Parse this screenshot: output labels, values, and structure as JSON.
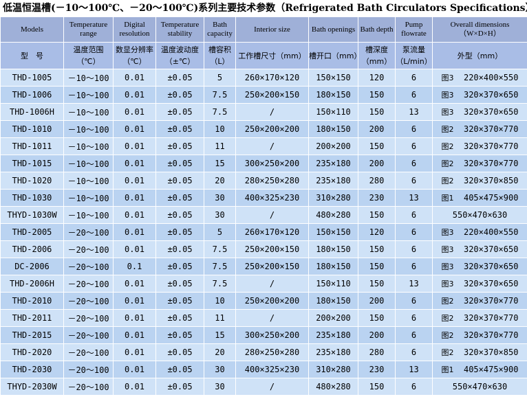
{
  "title": "低温恒温槽(－10～100℃、－20～100℃)系列主要技术参数（Refrigerated Bath Circulators Specifications）",
  "headers_en": [
    "Models",
    "Temperature range",
    "Digital resolution",
    "Temperature stability",
    "Bath capacity",
    "Interior size",
    "Bath openings",
    "Bath depth",
    "Pump flowrate",
    "Overall dimensions（W×D×H）"
  ],
  "headers_cn": [
    "型　号",
    "温度范围（℃）",
    "数显分辨率（℃）",
    "温度波动度（±℃）",
    "槽容积（L）",
    "工作槽尺寸（mm）",
    "槽开口（mm）",
    "槽深度（mm）",
    "泵流量（L/min）",
    "外型（mm）"
  ],
  "rows": [
    {
      "model": "THD-1005",
      "range": "－10～100",
      "res": "0.01",
      "stab": "±0.05",
      "cap": "5",
      "interior": "260×170×120",
      "opening": "150×150",
      "depth": "120",
      "flow": "6",
      "fig": "图3",
      "dims": "220×400×550"
    },
    {
      "model": "THD-1006",
      "range": "－10～100",
      "res": "0.01",
      "stab": "±0.05",
      "cap": "7.5",
      "interior": "250×200×150",
      "opening": "180×150",
      "depth": "150",
      "flow": "6",
      "fig": "图3",
      "dims": "320×370×650"
    },
    {
      "model": "THD-1006H",
      "range": "－10～100",
      "res": "0.01",
      "stab": "±0.05",
      "cap": "7.5",
      "interior": "/",
      "opening": "150×110",
      "depth": "150",
      "flow": "13",
      "fig": "图3",
      "dims": "320×370×650"
    },
    {
      "model": "THD-1010",
      "range": "－10～100",
      "res": "0.01",
      "stab": "±0.05",
      "cap": "10",
      "interior": "250×200×200",
      "opening": "180×150",
      "depth": "200",
      "flow": "6",
      "fig": "图2",
      "dims": "320×370×770"
    },
    {
      "model": "THD-1011",
      "range": "－10～100",
      "res": "0.01",
      "stab": "±0.05",
      "cap": "11",
      "interior": "/",
      "opening": "200×200",
      "depth": "150",
      "flow": "6",
      "fig": "图2",
      "dims": "320×370×770"
    },
    {
      "model": "THD-1015",
      "range": "－10～100",
      "res": "0.01",
      "stab": "±0.05",
      "cap": "15",
      "interior": "300×250×200",
      "opening": "235×180",
      "depth": "200",
      "flow": "6",
      "fig": "图2",
      "dims": "320×370×770"
    },
    {
      "model": "THD-1020",
      "range": "－10～100",
      "res": "0.01",
      "stab": "±0.05",
      "cap": "20",
      "interior": "280×250×280",
      "opening": "235×180",
      "depth": "280",
      "flow": "6",
      "fig": "图2",
      "dims": "320×370×850"
    },
    {
      "model": "THD-1030",
      "range": "－10～100",
      "res": "0.01",
      "stab": "±0.05",
      "cap": "30",
      "interior": "400×325×230",
      "opening": "310×280",
      "depth": "230",
      "flow": "13",
      "fig": "图1",
      "dims": "405×475×900"
    },
    {
      "model": "THYD-1030W",
      "range": "－10～100",
      "res": "0.01",
      "stab": "±0.05",
      "cap": "30",
      "interior": "/",
      "opening": "480×280",
      "depth": "150",
      "flow": "6",
      "fig": "",
      "dims": "550×470×630"
    },
    {
      "model": "THD-2005",
      "range": "－20～100",
      "res": "0.01",
      "stab": "±0.05",
      "cap": "5",
      "interior": "260×170×120",
      "opening": "150×150",
      "depth": "120",
      "flow": "6",
      "fig": "图3",
      "dims": "220×400×550"
    },
    {
      "model": "THD-2006",
      "range": "－20～100",
      "res": "0.01",
      "stab": "±0.05",
      "cap": "7.5",
      "interior": "250×200×150",
      "opening": "180×150",
      "depth": "150",
      "flow": "6",
      "fig": "图3",
      "dims": "320×370×650"
    },
    {
      "model": "DC-2006",
      "range": "－20～100",
      "res": "0.1",
      "stab": "±0.05",
      "cap": "7.5",
      "interior": "250×200×150",
      "opening": "180×150",
      "depth": "150",
      "flow": "6",
      "fig": "图3",
      "dims": "320×370×650"
    },
    {
      "model": "THD-2006H",
      "range": "－20～100",
      "res": "0.01",
      "stab": "±0.05",
      "cap": "7.5",
      "interior": "/",
      "opening": "150×110",
      "depth": "150",
      "flow": "13",
      "fig": "图3",
      "dims": "320×370×650"
    },
    {
      "model": "THD-2010",
      "range": "－20～100",
      "res": "0.01",
      "stab": "±0.05",
      "cap": "10",
      "interior": "250×200×200",
      "opening": "180×150",
      "depth": "200",
      "flow": "6",
      "fig": "图2",
      "dims": "320×370×770"
    },
    {
      "model": "THD-2011",
      "range": "－20～100",
      "res": "0.01",
      "stab": "±0.05",
      "cap": "11",
      "interior": "/",
      "opening": "200×200",
      "depth": "150",
      "flow": "6",
      "fig": "图2",
      "dims": "320×370×770"
    },
    {
      "model": "THD-2015",
      "range": "－20～100",
      "res": "0.01",
      "stab": "±0.05",
      "cap": "15",
      "interior": "300×250×200",
      "opening": "235×180",
      "depth": "200",
      "flow": "6",
      "fig": "图2",
      "dims": "320×370×770"
    },
    {
      "model": "THD-2020",
      "range": "－20～100",
      "res": "0.01",
      "stab": "±0.05",
      "cap": "20",
      "interior": "280×250×280",
      "opening": "235×180",
      "depth": "280",
      "flow": "6",
      "fig": "图2",
      "dims": "320×370×850"
    },
    {
      "model": "THD-2030",
      "range": "－20～100",
      "res": "0.01",
      "stab": "±0.05",
      "cap": "30",
      "interior": "400×325×230",
      "opening": "310×280",
      "depth": "230",
      "flow": "13",
      "fig": "图1",
      "dims": "405×475×900"
    },
    {
      "model": "THYD-2030W",
      "range": "－20～100",
      "res": "0.01",
      "stab": "±0.05",
      "cap": "30",
      "interior": "/",
      "opening": "480×280",
      "depth": "150",
      "flow": "6",
      "fig": "",
      "dims": "550×470×630"
    }
  ]
}
